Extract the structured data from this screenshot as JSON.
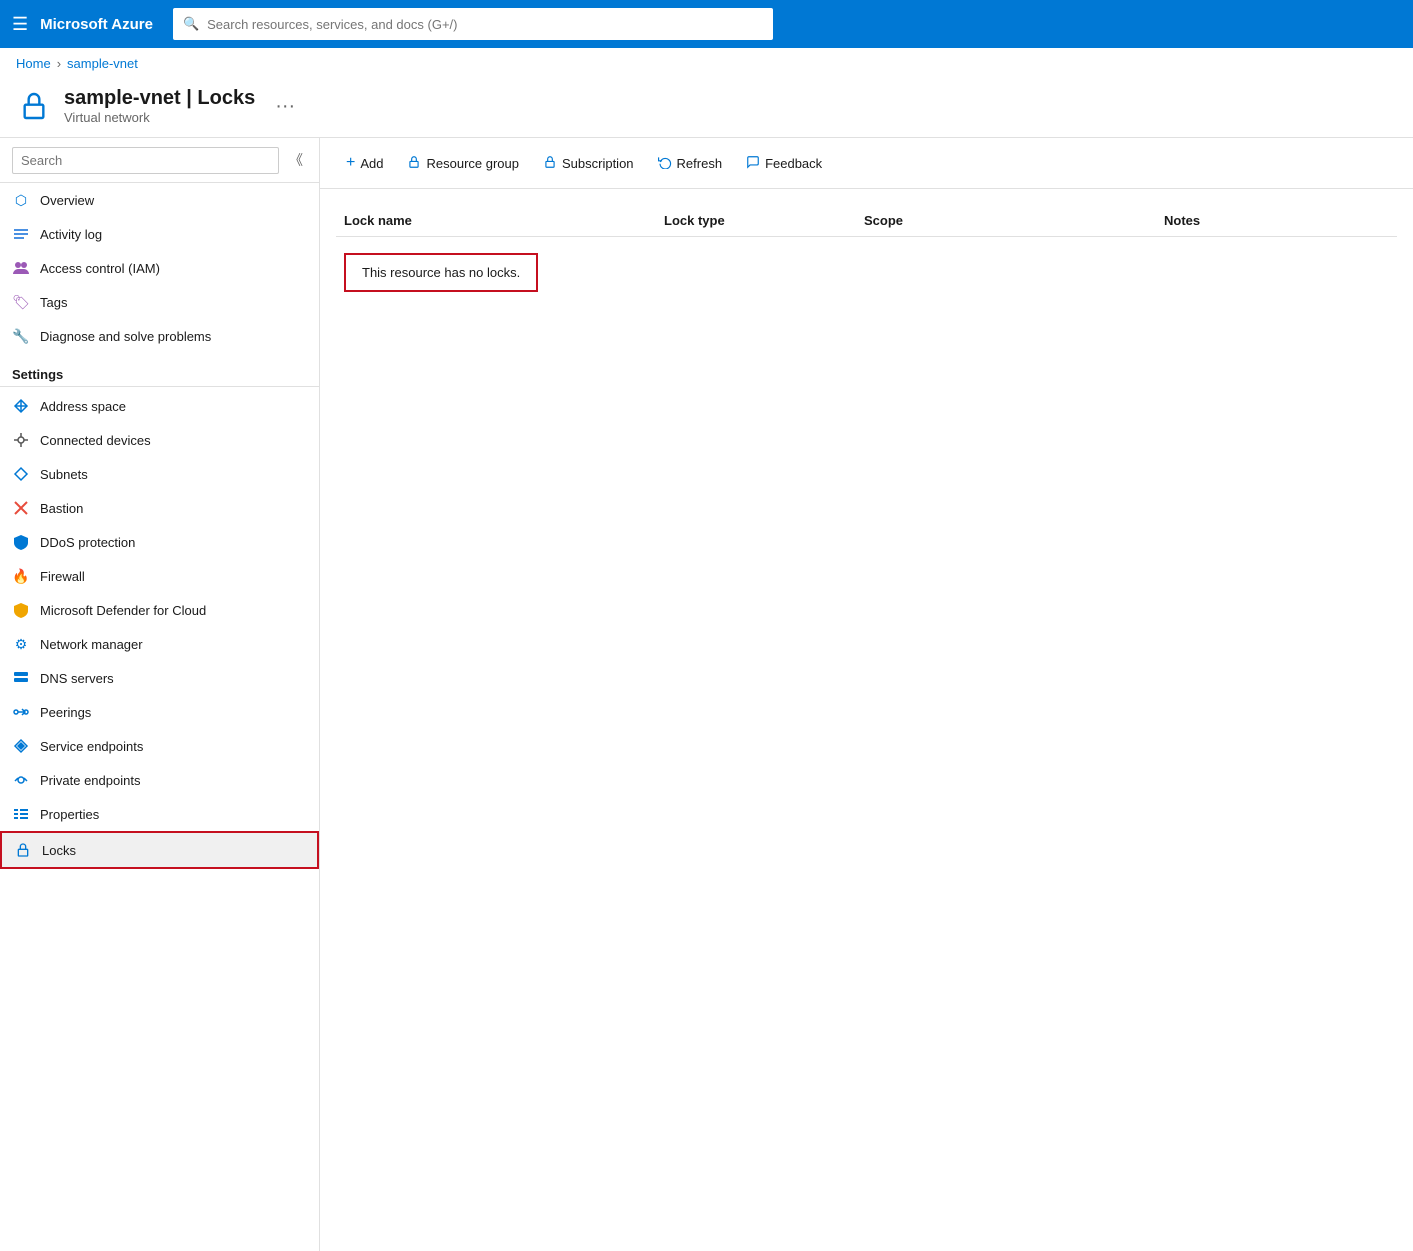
{
  "topnav": {
    "logo": "Microsoft Azure",
    "search_placeholder": "Search resources, services, and docs (G+/)"
  },
  "breadcrumb": {
    "home": "Home",
    "resource": "sample-vnet"
  },
  "page_header": {
    "title": "sample-vnet | Locks",
    "subtitle": "Virtual network",
    "more_label": "···"
  },
  "toolbar": {
    "add_label": "Add",
    "resource_group_label": "Resource group",
    "subscription_label": "Subscription",
    "refresh_label": "Refresh",
    "feedback_label": "Feedback"
  },
  "sidebar": {
    "search_placeholder": "Search",
    "items_top": [
      {
        "id": "overview",
        "label": "Overview",
        "icon": "⬡"
      },
      {
        "id": "activity-log",
        "label": "Activity log",
        "icon": "📋"
      },
      {
        "id": "access-control",
        "label": "Access control (IAM)",
        "icon": "👥"
      },
      {
        "id": "tags",
        "label": "Tags",
        "icon": "🏷"
      },
      {
        "id": "diagnose",
        "label": "Diagnose and solve problems",
        "icon": "🔧"
      }
    ],
    "settings_label": "Settings",
    "settings_items": [
      {
        "id": "address-space",
        "label": "Address space",
        "icon": "⬡"
      },
      {
        "id": "connected-devices",
        "label": "Connected devices",
        "icon": "🔌"
      },
      {
        "id": "subnets",
        "label": "Subnets",
        "icon": "⬡"
      },
      {
        "id": "bastion",
        "label": "Bastion",
        "icon": "✖"
      },
      {
        "id": "ddos-protection",
        "label": "DDoS protection",
        "icon": "🛡"
      },
      {
        "id": "firewall",
        "label": "Firewall",
        "icon": "🔥"
      },
      {
        "id": "defender",
        "label": "Microsoft Defender for Cloud",
        "icon": "🛡"
      },
      {
        "id": "network-manager",
        "label": "Network manager",
        "icon": "⚙"
      },
      {
        "id": "dns-servers",
        "label": "DNS servers",
        "icon": "🖥"
      },
      {
        "id": "peerings",
        "label": "Peerings",
        "icon": "🔗"
      },
      {
        "id": "service-endpoints",
        "label": "Service endpoints",
        "icon": "⬡"
      },
      {
        "id": "private-endpoints",
        "label": "Private endpoints",
        "icon": "⬡"
      },
      {
        "id": "properties",
        "label": "Properties",
        "icon": "≡"
      },
      {
        "id": "locks",
        "label": "Locks",
        "icon": "🔒"
      }
    ]
  },
  "table": {
    "col_lock_name": "Lock name",
    "col_lock_type": "Lock type",
    "col_scope": "Scope",
    "col_notes": "Notes",
    "no_locks_message": "This resource has no locks."
  }
}
